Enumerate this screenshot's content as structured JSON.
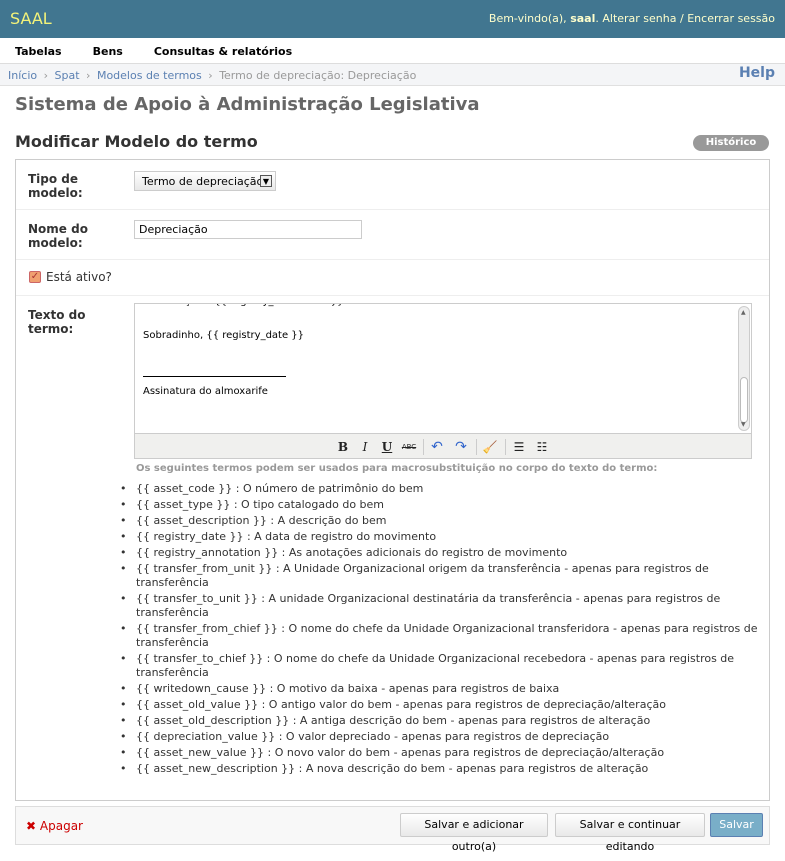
{
  "header": {
    "brand": "SAAL",
    "welcome": "Bem-vindo(a),",
    "username": "saal",
    "change_password": "Alterar senha",
    "separator": "/",
    "logout": "Encerrar sessão"
  },
  "nav": {
    "items": [
      "Tabelas",
      "Bens",
      "Consultas & relatórios"
    ]
  },
  "breadcrumbs": {
    "items": [
      "Início",
      "Spat",
      "Modelos de termos",
      "Termo de depreciação: Depreciação"
    ],
    "separator": "›",
    "help": "Help"
  },
  "site_title": "Sistema de Apoio à Administração Legislativa",
  "page_title": "Modificar Modelo do termo",
  "history_button": "Histórico",
  "form": {
    "tipo_label": "Tipo de modelo:",
    "tipo_value": "Termo de depreciação",
    "nome_label": "Nome do modelo:",
    "nome_value": "Depreciação",
    "ativo_label": "Está ativo?",
    "ativo_checked": true,
    "texto_label": "Texto do termo:",
    "editor_lines": [
      "Observações: {{ registry_annotation }}",
      "",
      "Sobradinho, {{ registry_date }}",
      "",
      "",
      "Assinatura do almoxarife"
    ],
    "toolbar_icons": [
      "bold-icon",
      "italic-icon",
      "underline-icon",
      "strikethrough-icon",
      "undo-icon",
      "redo-icon",
      "cleanup-icon",
      "bullet-list-icon",
      "numbered-list-icon"
    ],
    "macros_note": "Os seguintes termos podem ser usados para macrosubstituição no corpo do texto do termo:",
    "macros": [
      "{{ asset_code }} : O número de patrimônio do bem",
      "{{ asset_type }} : O tipo catalogado do bem",
      "{{ asset_description }} : A descrição do bem",
      "{{ registry_date }} : A data de registro do movimento",
      "{{ registry_annotation }} : As anotações adicionais do registro de movimento",
      "{{ transfer_from_unit }} : A Unidade Organizacional origem da transferência - apenas para registros de transferência",
      "{{ transfer_to_unit }} : A unidade Organizacional destinatária da transferência - apenas para registros de transferência",
      "{{ transfer_from_chief }} : O nome do chefe da Unidade Organizacional transferidora - apenas para registros de transferência",
      "{{ transfer_to_chief }} : O nome do chefe da Unidade Organizacional recebedora - apenas para registros de transferência",
      "{{ writedown_cause }} : O motivo da baixa - apenas para registros de baixa",
      "{{ asset_old_value }} : O antigo valor do bem - apenas para registros de depreciação/alteração",
      "{{ asset_old_description }} : A antiga descrição do bem - apenas para registros de alteração",
      "{{ depreciation_value }} : O valor depreciado - apenas para registros de depreciação",
      "{{ asset_new_value }} : O novo valor do bem - apenas para registros de depreciação/alteração",
      "{{ asset_new_description }} : A nova descrição do bem - apenas para registros de alteração"
    ]
  },
  "submit_row": {
    "delete": "Apagar",
    "save_add_another": "Salvar e adicionar outro(a)",
    "save_continue": "Salvar e continuar editando",
    "save": "Salvar"
  }
}
